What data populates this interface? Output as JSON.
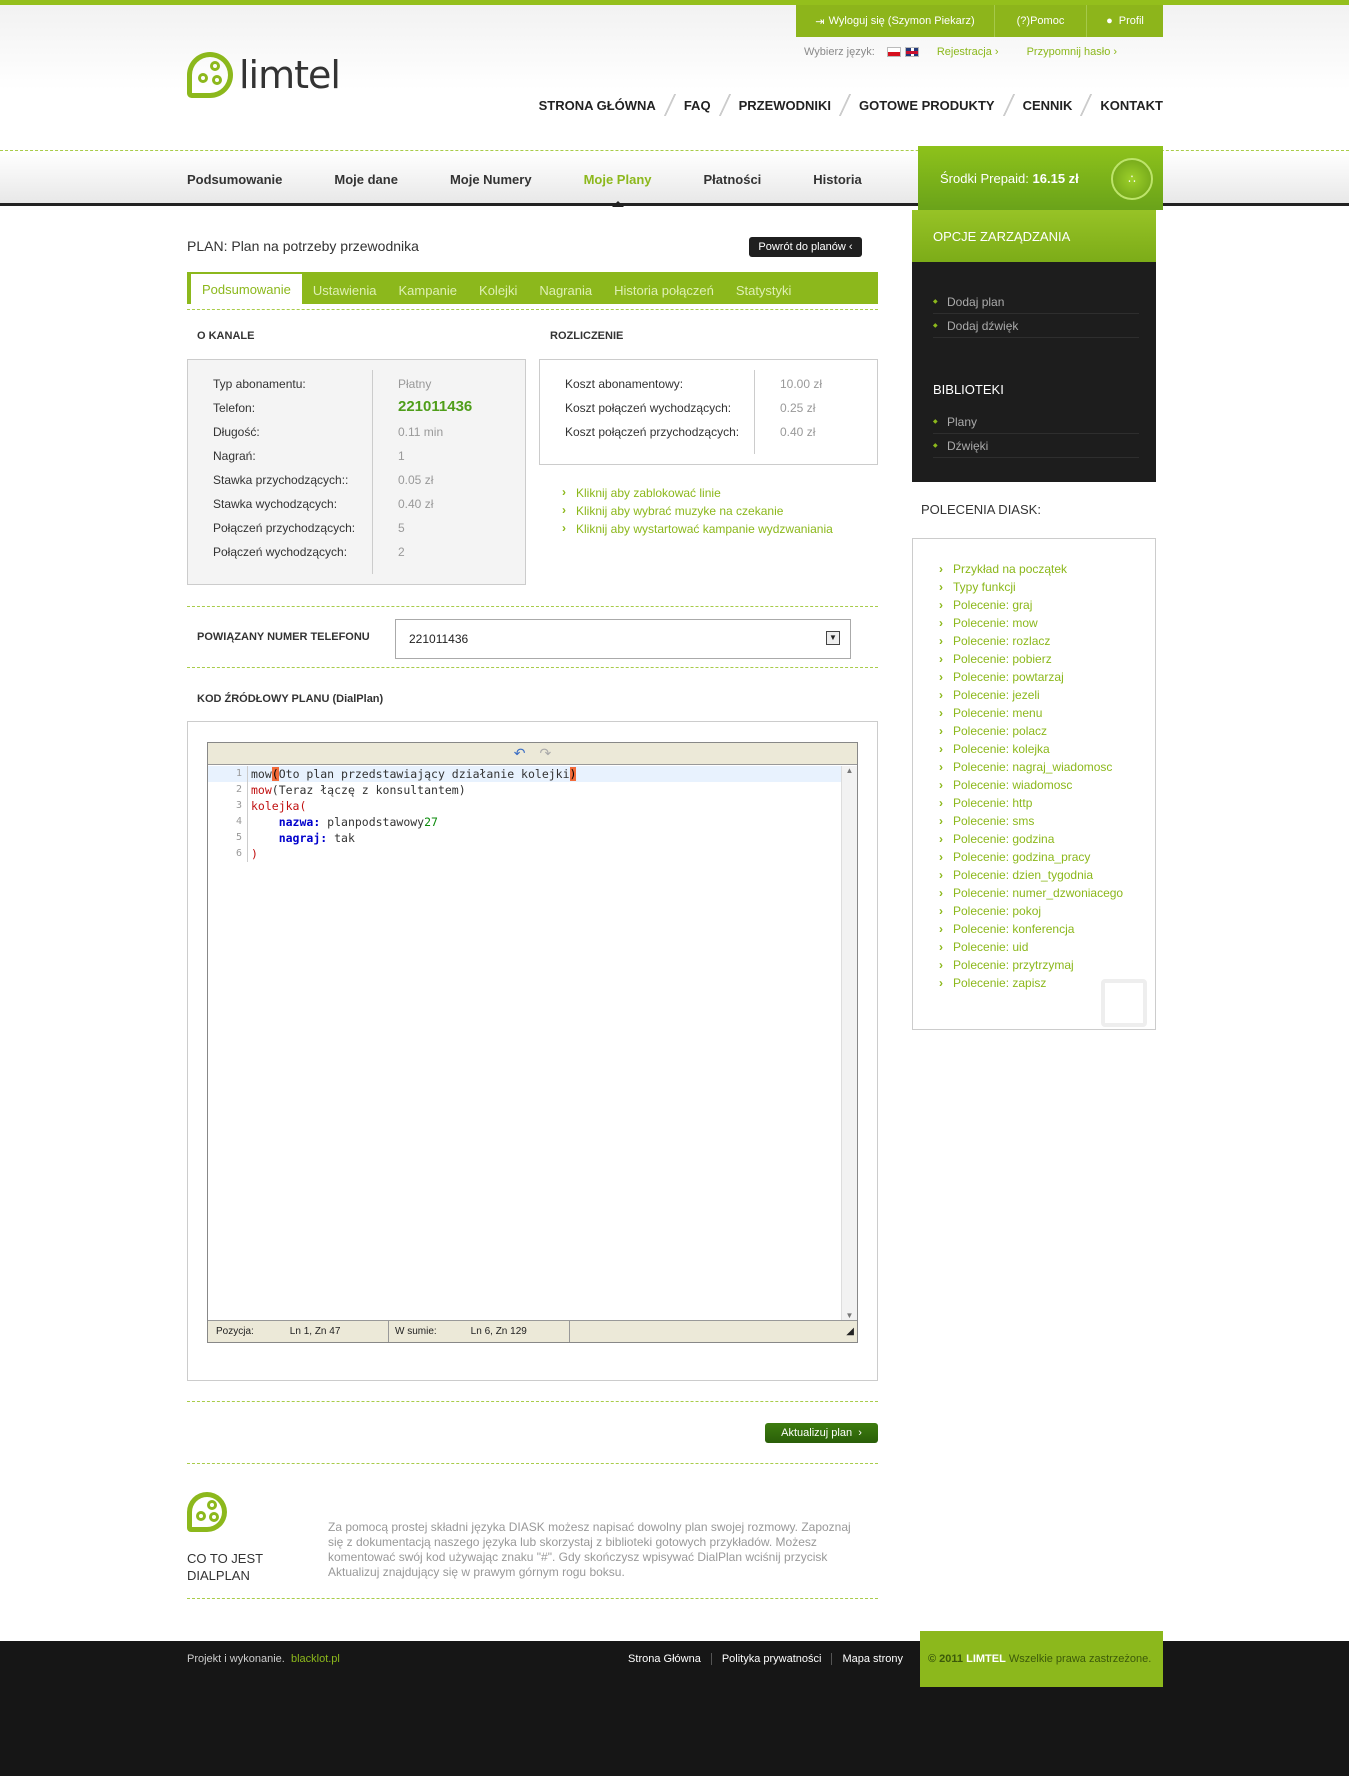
{
  "topbar": {
    "logout": "Wyloguj się (Szymon Piekarz)",
    "help": "Pomoc",
    "help_mark": "(?)",
    "profile": "Profil"
  },
  "subtop": {
    "language_label": "Wybierz język:",
    "register": "Rejestracja",
    "remind_password": "Przypomnij hasło"
  },
  "logo": {
    "text": "limtel"
  },
  "main_nav": [
    "STRONA GŁÓWNA",
    "FAQ",
    "PRZEWODNIKI",
    "GOTOWE PRODUKTY",
    "CENNIK",
    "KONTAKT"
  ],
  "sub_nav": {
    "items": [
      "Podsumowanie",
      "Moje dane",
      "Moje Numery",
      "Moje Plany",
      "Płatności",
      "Historia"
    ],
    "active": "Moje Plany"
  },
  "prepaid": {
    "label": "Środki Prepaid:",
    "value": "16.15 zł"
  },
  "plan": {
    "title": "PLAN: Plan na potrzeby przewodnika",
    "back_button": "Powrót do planów"
  },
  "tabs": {
    "items": [
      "Podsumowanie",
      "Ustawienia",
      "Kampanie",
      "Kolejki",
      "Nagrania",
      "Historia połączeń",
      "Statystyki"
    ],
    "active": "Podsumowanie"
  },
  "o_kanale": {
    "title": "O KANALE",
    "rows": [
      {
        "k": "Typ abonamentu:",
        "v": "Płatny"
      },
      {
        "k": "Telefon:",
        "v": "221011436"
      },
      {
        "k": "Długość:",
        "v": "0.11 min"
      },
      {
        "k": "Nagrań:",
        "v": "1"
      },
      {
        "k": "Stawka przychodzących::",
        "v": "0.05 zł"
      },
      {
        "k": "Stawka wychodzących:",
        "v": "0.40 zł"
      },
      {
        "k": "Połączeń przychodzących:",
        "v": "5"
      },
      {
        "k": "Połączeń wychodzących:",
        "v": "2"
      }
    ]
  },
  "rozliczenie": {
    "title": "ROZLICZENIE",
    "rows": [
      {
        "k": "Koszt abonamentowy:",
        "v": "10.00 zł"
      },
      {
        "k": "Koszt połączeń wychodzących:",
        "v": "0.25 zł"
      },
      {
        "k": "Koszt połączeń przychodzących:",
        "v": "0.40 zł"
      }
    ],
    "links": [
      "Kliknij aby zablokować linie",
      "Kliknij aby wybrać muzyke na czekanie",
      "Kliknij aby wystartować kampanie wydzwaniania"
    ]
  },
  "linked_phone": {
    "label": "POWIĄZANY NUMER TELEFONU",
    "value": "221011436"
  },
  "source": {
    "title": "KOD ŹRÓDŁOWY PLANU (DialPlan)",
    "status": {
      "pos_label": "Pozycja:",
      "pos_value": "Ln 1, Zn 47",
      "total_label": "W sumie:",
      "total_value": "Ln 6, Zn 129"
    }
  },
  "update_button": "Aktualizuj plan",
  "dialplan_info": {
    "title_line1": "CO TO JEST",
    "title_line2": "DIALPLAN",
    "text": "Za pomocą prostej składni języka DIASK możesz napisać dowolny plan swojej rozmowy. Zapoznaj się z dokumentacją naszego języka lub skorzystaj z biblioteki gotowych przykładów. Możesz komentować swój kod używając znaku \"#\". Gdy skończysz wpisywać DialPlan wciśnij przycisk Aktualizuj znajdujący się w prawym górnym rogu boksu."
  },
  "sidebar": {
    "opcje_title": "OPCJE ZARZĄDZANIA",
    "opcje_items": [
      "Dodaj plan",
      "Dodaj dźwięk"
    ],
    "biblioteki_title": "BIBLIOTEKI",
    "biblioteki_items": [
      "Plany",
      "Dźwięki"
    ],
    "polecenia_title": "POLECENIA DIASK:",
    "polecenia": [
      "Przykład na początek",
      "Typy funkcji",
      "Polecenie: graj",
      "Polecenie: mow",
      "Polecenie: rozlacz",
      "Polecenie: pobierz",
      "Polecenie: powtarzaj",
      "Polecenie: jezeli",
      "Polecenie: menu",
      "Polecenie: polacz",
      "Polecenie: kolejka",
      "Polecenie: nagraj_wiadomosc",
      "Polecenie: wiadomosc",
      "Polecenie: http",
      "Polecenie: sms",
      "Polecenie: godzina",
      "Polecenie: godzina_pracy",
      "Polecenie: dzien_tygodnia",
      "Polecenie: numer_dzwoniacego",
      "Polecenie: pokoj",
      "Polecenie: konferencja",
      "Polecenie: uid",
      "Polecenie: przytrzymaj",
      "Polecenie: zapisz"
    ]
  },
  "footer": {
    "credit_label": "Projekt i wykonanie.",
    "credit_link": "blacklot.pl",
    "links": [
      "Strona Główna",
      "Polityka prywatności",
      "Mapa strony"
    ],
    "copyright_year": "© 2011",
    "copyright_brand": "LIMTEL",
    "copyright_text": "Wszelkie prawa zastrzeżone."
  },
  "colors": {
    "accent": "#8cb81c",
    "dark": "#1d1d1d"
  }
}
